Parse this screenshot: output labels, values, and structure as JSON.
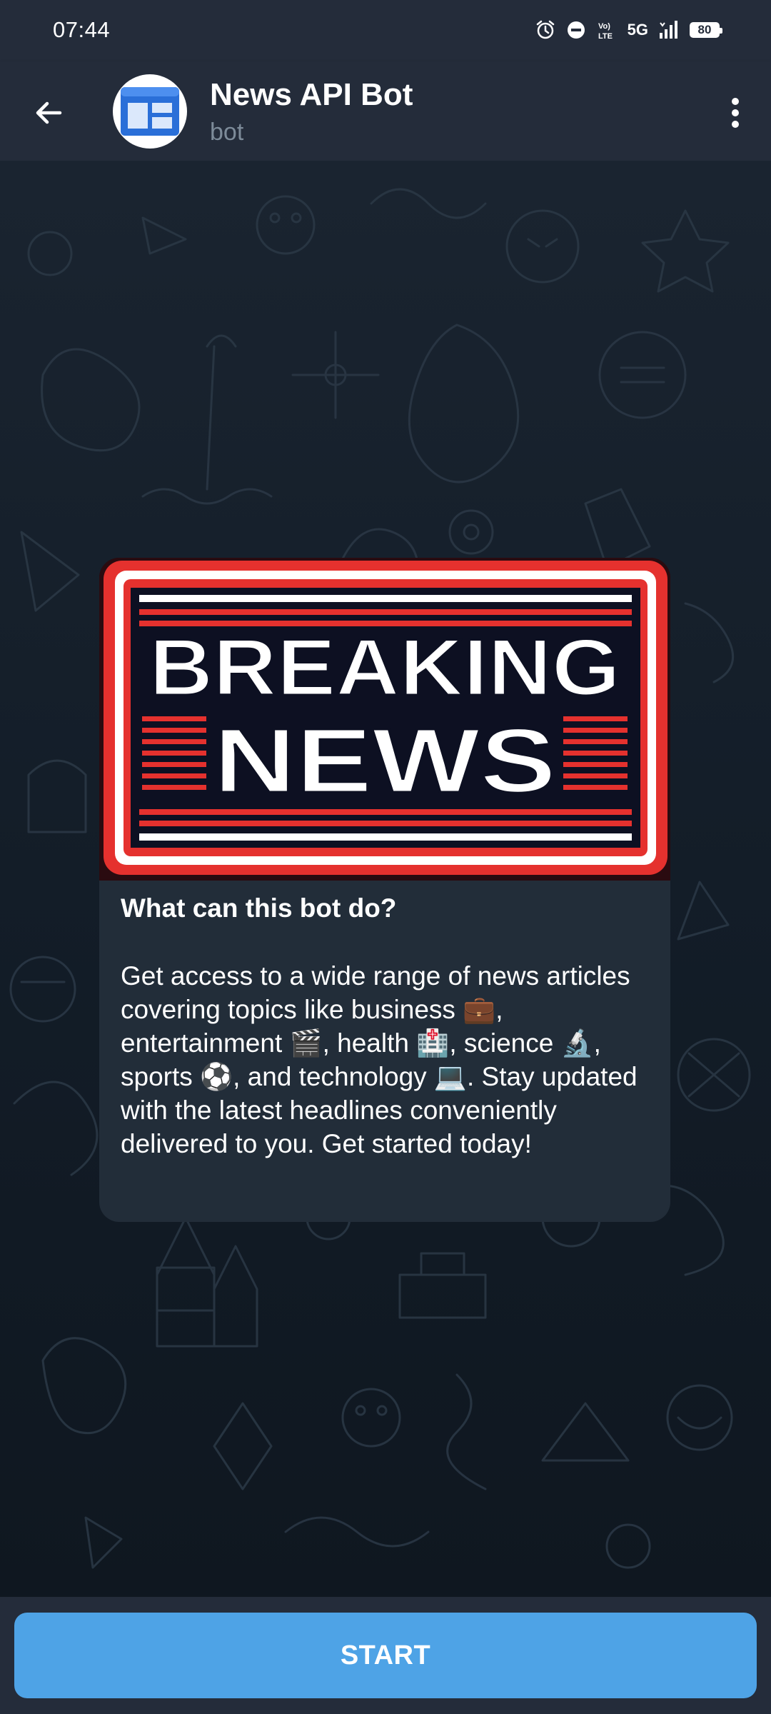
{
  "status_bar": {
    "time": "07:44",
    "network": "5G",
    "volte": "Vo) LTE",
    "battery": "80",
    "icons": [
      "alarm-icon",
      "do-not-disturb-icon",
      "volte-icon",
      "signal-icon",
      "battery-icon"
    ]
  },
  "header": {
    "title": "News API Bot",
    "subtitle": "bot",
    "back_icon": "arrow-left-icon",
    "menu_icon": "more-vertical-icon"
  },
  "card": {
    "image_text_line1": "BREAKING",
    "image_text_line2": "NEWS",
    "heading": "What can this bot do?",
    "body": "Get access to a wide range of news articles covering topics like business 💼, entertainment 🎬, health 🏥, science 🔬, sports ⚽, and technology 💻. Stay updated with the latest headlines conveniently delivered to you. Get started today!"
  },
  "bottom": {
    "start_label": "START"
  },
  "colors": {
    "header_bg": "#242c3a",
    "card_bg": "#222d39",
    "accent": "#4ea3e6",
    "subtitle": "#7d8b99",
    "news_red": "#e5312e"
  }
}
